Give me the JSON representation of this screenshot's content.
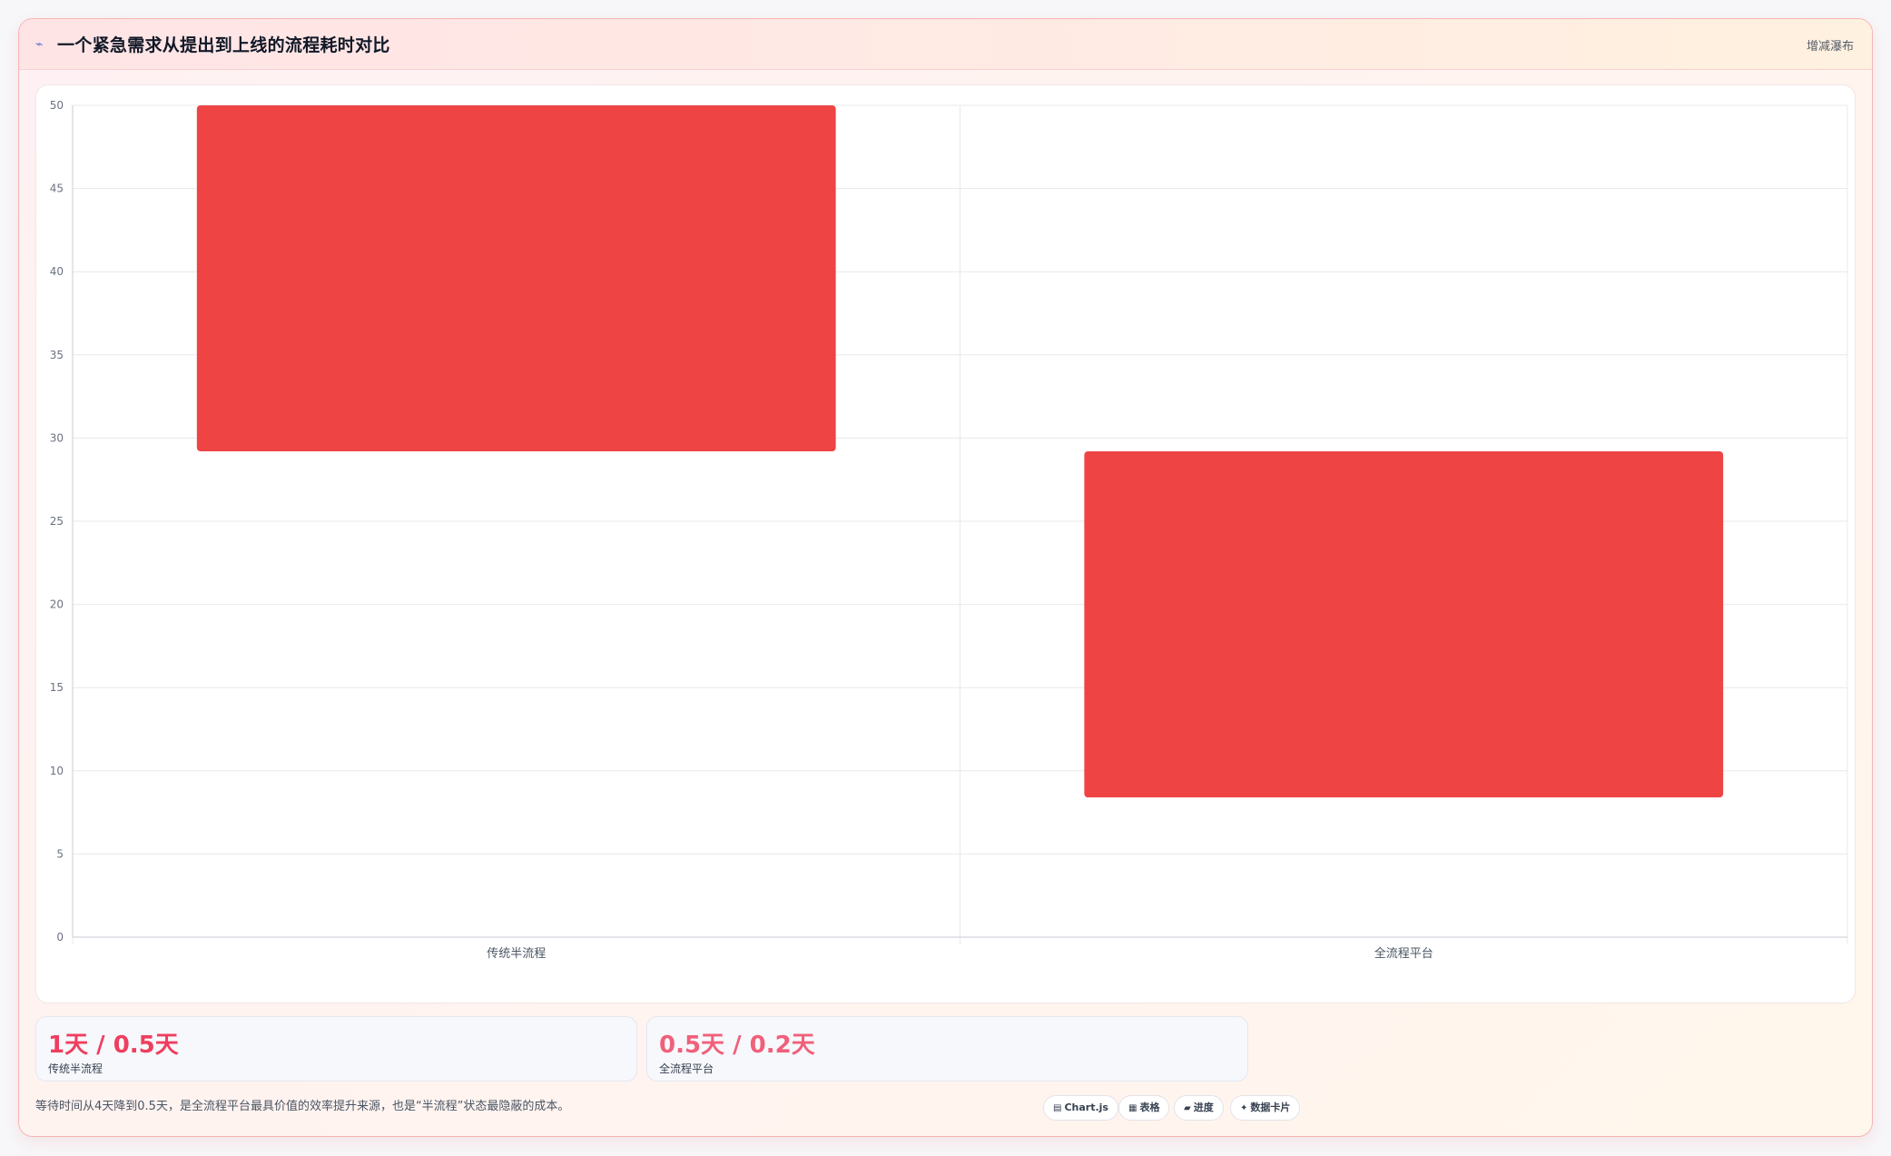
{
  "header": {
    "title_icon": "chart-line-icon",
    "title": "一个紧急需求从提出到上线的流程耗时对比",
    "type_label": "增减瀑布"
  },
  "colors": {
    "bar": "#ef4444",
    "stat_value_1": "#ef3e5e",
    "stat_value_2": "#f0607a"
  },
  "chart_data": {
    "type": "bar",
    "subtype": "floating-range",
    "categories": [
      "传统半流程",
      "全流程平台"
    ],
    "series": [
      {
        "ranges": [
          [
            29.2,
            50
          ],
          [
            8.4,
            29.2
          ]
        ]
      }
    ],
    "ylim": [
      0,
      50
    ],
    "yticks": [
      0,
      5,
      10,
      15,
      20,
      25,
      30,
      35,
      40,
      45,
      50
    ],
    "grid": true,
    "legend": "none"
  },
  "stats": [
    {
      "value": "1天 / 0.5天",
      "label": "传统半流程"
    },
    {
      "value": "0.5天 / 0.2天",
      "label": "全流程平台"
    }
  ],
  "note": "等待时间从4天降到0.5天，是全流程平台最具价值的效率提升来源，也是“半流程”状态最隐蔽的成本。",
  "chips": [
    {
      "icon": "chart-icon",
      "glyph": "▤",
      "label": "Chart.js"
    },
    {
      "icon": "table-icon",
      "glyph": "▦",
      "label": "表格"
    },
    {
      "icon": "progress-icon",
      "glyph": "▰",
      "label": "进度"
    },
    {
      "icon": "sparkle-icon",
      "glyph": "✦",
      "label": "数据卡片"
    }
  ]
}
